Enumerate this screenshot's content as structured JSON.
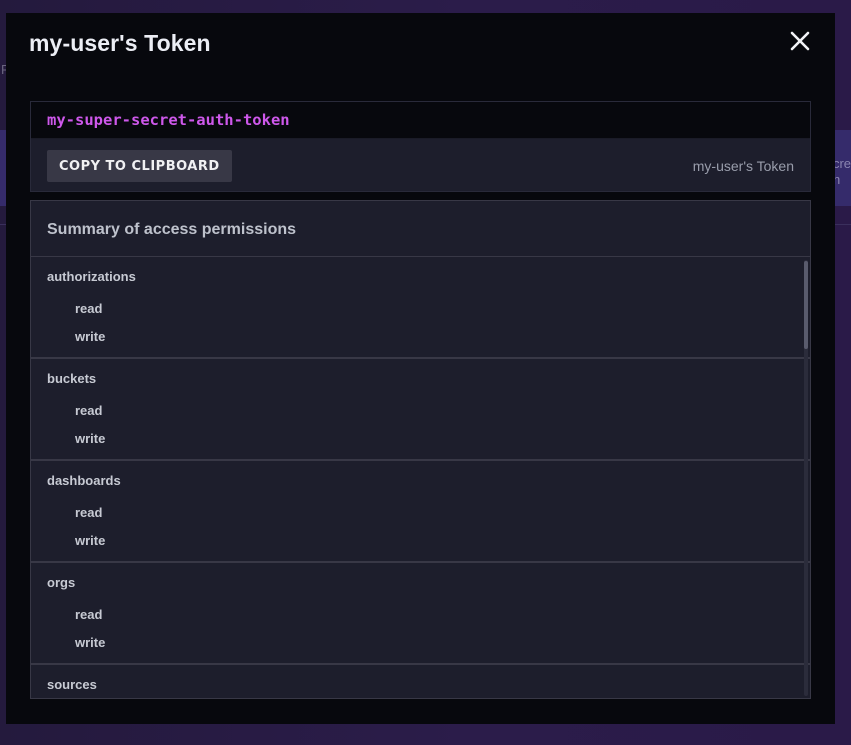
{
  "modal": {
    "title": "my-user's Token"
  },
  "token": {
    "value": "my-super-secret-auth-token",
    "copy_label": "COPY TO CLIPBOARD",
    "label": "my-user's Token"
  },
  "permissions": {
    "header": "Summary of access permissions",
    "groups": [
      {
        "resource": "authorizations",
        "actions": [
          "read",
          "write"
        ]
      },
      {
        "resource": "buckets",
        "actions": [
          "read",
          "write"
        ]
      },
      {
        "resource": "dashboards",
        "actions": [
          "read",
          "write"
        ]
      },
      {
        "resource": "orgs",
        "actions": [
          "read",
          "write"
        ]
      },
      {
        "resource": "sources",
        "actions": []
      }
    ]
  },
  "icons": {
    "close": "close-icon"
  },
  "colors": {
    "token_text": "#ce58eb",
    "modal_bg": "#07080d",
    "panel_bg": "#1d1e2c",
    "accent_band": "#352b6b"
  },
  "background": {
    "left_glimpse": "F",
    "right_glimpse": "cre\nh"
  }
}
